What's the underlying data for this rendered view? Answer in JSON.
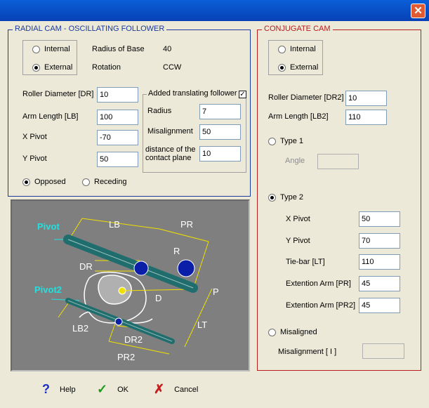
{
  "window": {
    "close_glyph": "✕"
  },
  "radial": {
    "title": "RADIAL CAM - OSCILLATING FOLLOWER",
    "internal": "Internal",
    "external": "External",
    "radius_label": "Radius of Base",
    "radius_value": "40",
    "rotation_label": "Rotation",
    "rotation_value": "CCW",
    "roller_label": "Roller Diameter [DR]",
    "roller_value": "10",
    "arm_label": "Arm Length [LB]",
    "arm_value": "100",
    "xpivot_label": "X Pivot",
    "xpivot_value": "-70",
    "ypivot_label": "Y Pivot",
    "ypivot_value": "50",
    "added_label": "Added translating follower",
    "added_radius_label": "Radius",
    "added_radius_value": "7",
    "misalignment_label": "Misalignment",
    "misalignment_value": "50",
    "distance_label1": "distance of the",
    "distance_label2": "contact plane",
    "distance_value": "10",
    "opposed": "Opposed",
    "receding": "Receding"
  },
  "diagram": {
    "pivot": "Pivot",
    "pivot2": "Pivot2",
    "lb": "LB",
    "pr": "PR",
    "r": "R",
    "dr": "DR",
    "d": "D",
    "p": "P",
    "lt": "LT",
    "lb2": "LB2",
    "dr2": "DR2",
    "pr2": "PR2"
  },
  "conjugate": {
    "title": "CONJUGATE CAM",
    "internal": "Internal",
    "external": "External",
    "roller_label": "Roller Diameter [DR2]",
    "roller_value": "10",
    "arm_label": "Arm Length [LB2]",
    "arm_value": "110",
    "type1": "Type 1",
    "angle_label": "Angle",
    "type2": "Type 2",
    "xpivot_label": "X Pivot",
    "xpivot_value": "50",
    "ypivot_label": "Y Pivot",
    "ypivot_value": "70",
    "tiebar_label": "Tie-bar [LT]",
    "tiebar_value": "110",
    "ext_pr_label": "Extention Arm [PR]",
    "ext_pr_value": "45",
    "ext_pr2_label": "Extention Arm [PR2]",
    "ext_pr2_value": "45",
    "misaligned": "Misaligned",
    "misalignment_label": "Misalignment [ I ]"
  },
  "buttons": {
    "help": "Help",
    "ok": "OK",
    "cancel": "Cancel"
  },
  "colors": {
    "blue_frame": "#1a3a9c",
    "red_frame": "#b81c1c",
    "cyan_label": "#22e0e0",
    "teal_arm": "#1f6d6d"
  }
}
